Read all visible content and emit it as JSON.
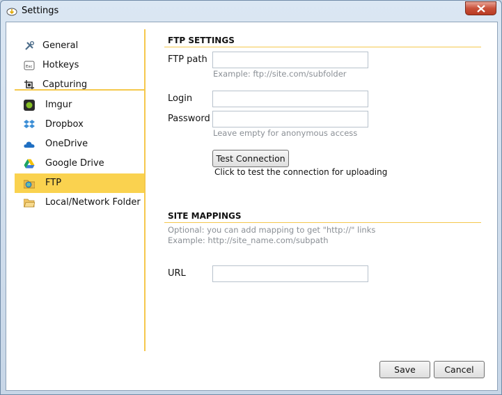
{
  "window": {
    "title": "Settings"
  },
  "sidebar": {
    "items": [
      {
        "label": "General",
        "icon": "tools-icon"
      },
      {
        "label": "Hotkeys",
        "icon": "esc-key-icon"
      },
      {
        "label": "Capturing",
        "icon": "capture-crop-icon"
      },
      {
        "label": "Imgur",
        "icon": "imgur-icon"
      },
      {
        "label": "Dropbox",
        "icon": "dropbox-icon"
      },
      {
        "label": "OneDrive",
        "icon": "onedrive-cloud-icon"
      },
      {
        "label": "Google Drive",
        "icon": "google-drive-icon"
      },
      {
        "label": "FTP",
        "icon": "ftp-globe-icon"
      },
      {
        "label": "Local/Network Folder",
        "icon": "folder-icon"
      }
    ],
    "active": "FTP",
    "accent": "#fad24f"
  },
  "ftp": {
    "section_title": "FTP SETTINGS",
    "path_label": "FTP path",
    "path_value": "",
    "path_hint": "Example: ftp://site.com/subfolder",
    "login_label": "Login",
    "login_value": "",
    "password_label": "Password",
    "password_value": "",
    "password_hint": "Leave empty for anonymous access",
    "test_button": "Test Connection",
    "test_note": "Click to test the connection for uploading"
  },
  "mappings": {
    "section_title": "SITE MAPPINGS",
    "hint_line1": "Optional: you can add mapping to get \"http://\" links",
    "hint_line2": "Example: http://site_name.com/subpath",
    "url_label": "URL",
    "url_value": ""
  },
  "footer": {
    "save_label": "Save",
    "cancel_label": "Cancel"
  }
}
